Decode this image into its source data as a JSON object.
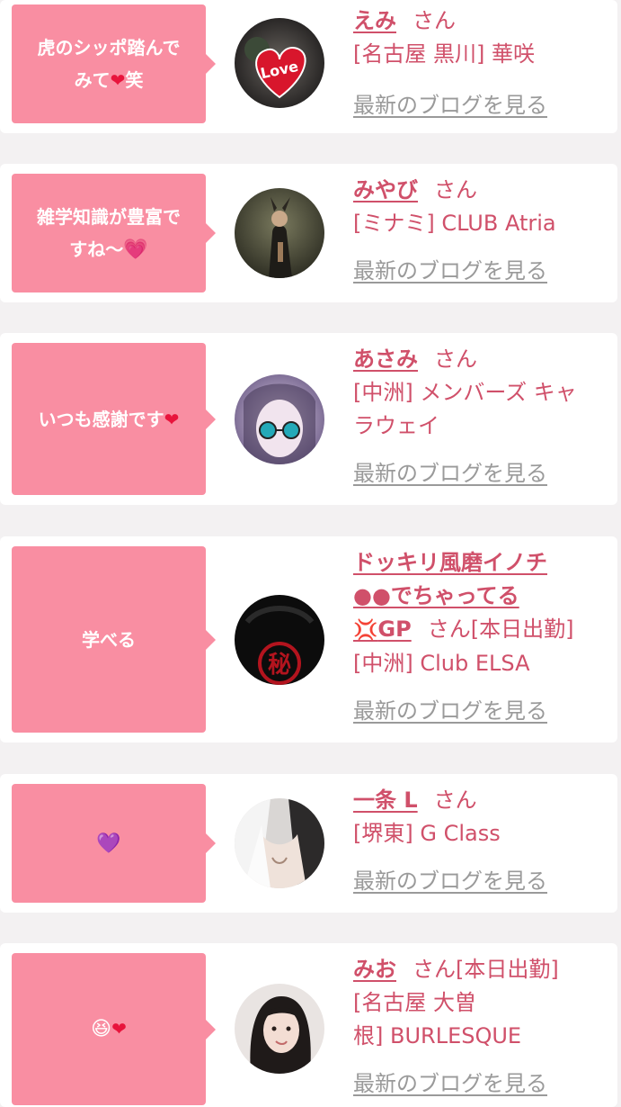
{
  "blog_link_label": "最新のブログを見る",
  "san": "さん",
  "entries": [
    {
      "comment_a": "虎のシッポ踏んで",
      "comment_b": "みて",
      "comment_heart": "❤",
      "comment_c": "笑",
      "name": "えみ",
      "suffix": "",
      "location": "[名古屋 黒川] 華咲",
      "avatar_text": "Love"
    },
    {
      "comment_a": "雑学知識が豊富で",
      "comment_b": "すね〜",
      "comment_heart": "💗",
      "name": "みやび",
      "suffix": "",
      "location": "[ミナミ] CLUB Atria"
    },
    {
      "comment_a": "いつも感謝です",
      "comment_heart": "❤",
      "name": "あさみ",
      "suffix": "",
      "location_a": "[中洲] メンバーズ キャ",
      "location_b": "ラウェイ"
    },
    {
      "comment_a": "学べる",
      "name_a": "ドッキリ風磨イノチ",
      "name_b": "●●でちゃってる",
      "name_c_icon": "💢",
      "name_c": "GP",
      "suffix": "[本日出勤]",
      "location": "[中洲] Club ELSA",
      "avatar_text": "秘"
    },
    {
      "comment_heart": "💜",
      "name": "一条 L",
      "suffix": "",
      "location": "[堺東] G Class"
    },
    {
      "comment_face": "😆",
      "comment_heart": "❤",
      "name": "みお",
      "suffix": "[本日出勤]",
      "location_a": "[名古屋 大曽",
      "location_b": "根] BURLESQUE"
    }
  ],
  "colors": {
    "bubble": "#f98ea2",
    "accent": "#d0506a",
    "link_gray": "#9a9a9a",
    "background": "#f3f1f2"
  }
}
